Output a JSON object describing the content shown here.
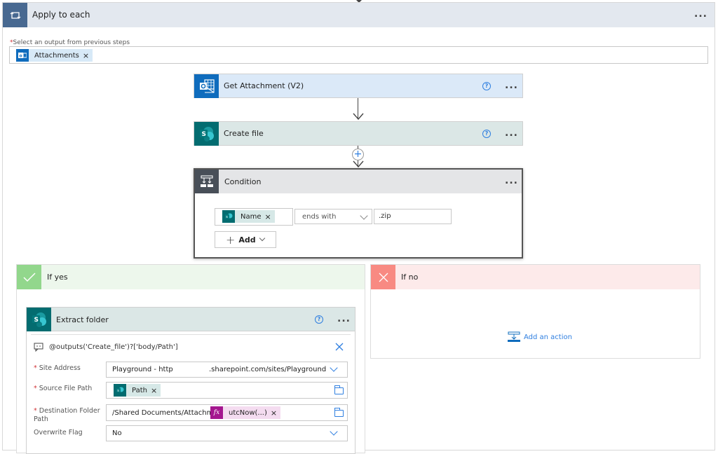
{
  "apply_to_each": {
    "title": "Apply to each",
    "more_label": "...",
    "select_label": "Select an output from previous steps",
    "required_mark": "*",
    "token": {
      "label": "Attachments",
      "remove": "×",
      "icon": "outlook-icon"
    }
  },
  "actions": {
    "get_attachment": {
      "title": "Get Attachment (V2)",
      "help": "?",
      "more": "...",
      "icon": "outlook-icon",
      "color": "#0f6cbd"
    },
    "create_file": {
      "title": "Create file",
      "help": "?",
      "more": "...",
      "icon": "sharepoint-icon",
      "color": "#036c70"
    },
    "insert_step": "+"
  },
  "condition": {
    "title": "Condition",
    "more": "...",
    "left_token": {
      "label": "Name",
      "remove": "×",
      "icon": "sharepoint-icon"
    },
    "operator": "ends with",
    "value": ".zip",
    "add_button": {
      "plus": "+",
      "label": "Add"
    }
  },
  "if_yes": {
    "title": "If yes",
    "color": "#92d78c",
    "extract_folder": {
      "title": "Extract folder",
      "help": "?",
      "more": "...",
      "comment": "@outputs('Create_file')?['body/Path']",
      "fields": {
        "site_address": {
          "label": "Site Address",
          "required": true,
          "value_left": "Playground - http",
          "value_right": ".sharepoint.com/sites/Playground"
        },
        "source_file_path": {
          "label": "Source File Path",
          "required": true,
          "token": "Path",
          "remove": "×"
        },
        "destination_folder_path": {
          "label": "Destination Folder Path",
          "required": true,
          "prefix": "/Shared Documents/Attachment_",
          "fx_token": "utcNow(...)",
          "fx_icon": "fx",
          "remove": "×"
        },
        "overwrite_flag": {
          "label": "Overwrite Flag",
          "required": false,
          "value": "No"
        }
      }
    }
  },
  "if_no": {
    "title": "If no",
    "color": "#f88a82",
    "add_action": "Add an action"
  }
}
